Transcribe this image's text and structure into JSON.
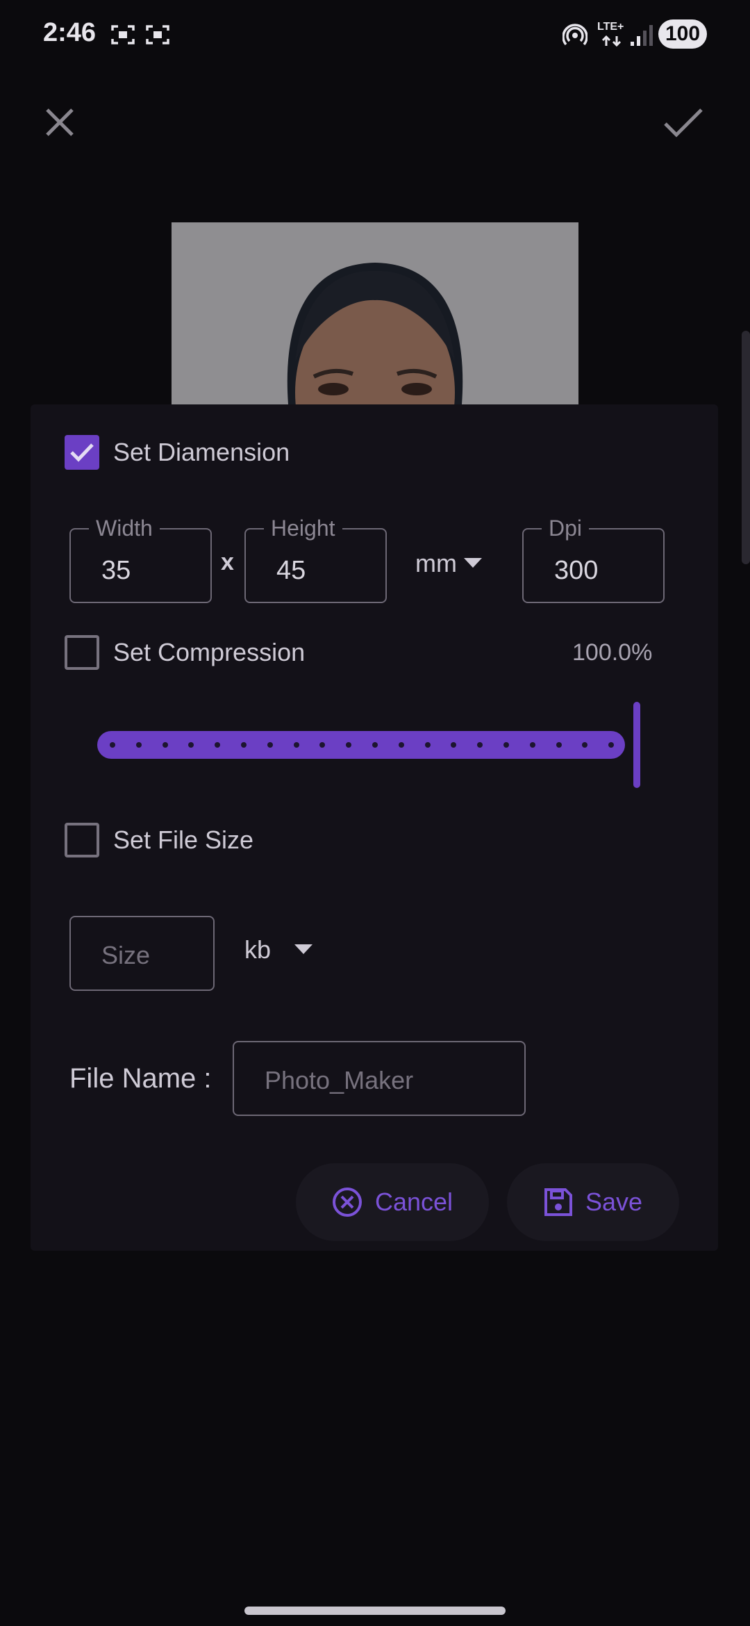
{
  "status_bar": {
    "time": "2:46",
    "network": "LTE+",
    "battery": "100"
  },
  "dialog": {
    "set_dimension_label": "Set Diamension",
    "set_dimension_checked": true,
    "width": {
      "legend": "Width",
      "value": "35"
    },
    "separator": "x",
    "height": {
      "legend": "Height",
      "value": "45"
    },
    "unit": "mm",
    "dpi": {
      "legend": "Dpi",
      "value": "300"
    },
    "set_compression_label": "Set Compression",
    "set_compression_checked": false,
    "compression_value": "100.0%",
    "compression_level": 1.0,
    "set_file_size_label": "Set File Size",
    "set_file_size_checked": false,
    "size_placeholder": "Size",
    "size_unit": "kb",
    "file_name_label": "File Name :",
    "file_name_placeholder": "Photo_Maker",
    "cancel_label": "Cancel",
    "save_label": "Save"
  },
  "colors": {
    "accent": "#6b3fc4",
    "background": "#0b0a0d",
    "dialog": "#131118"
  }
}
